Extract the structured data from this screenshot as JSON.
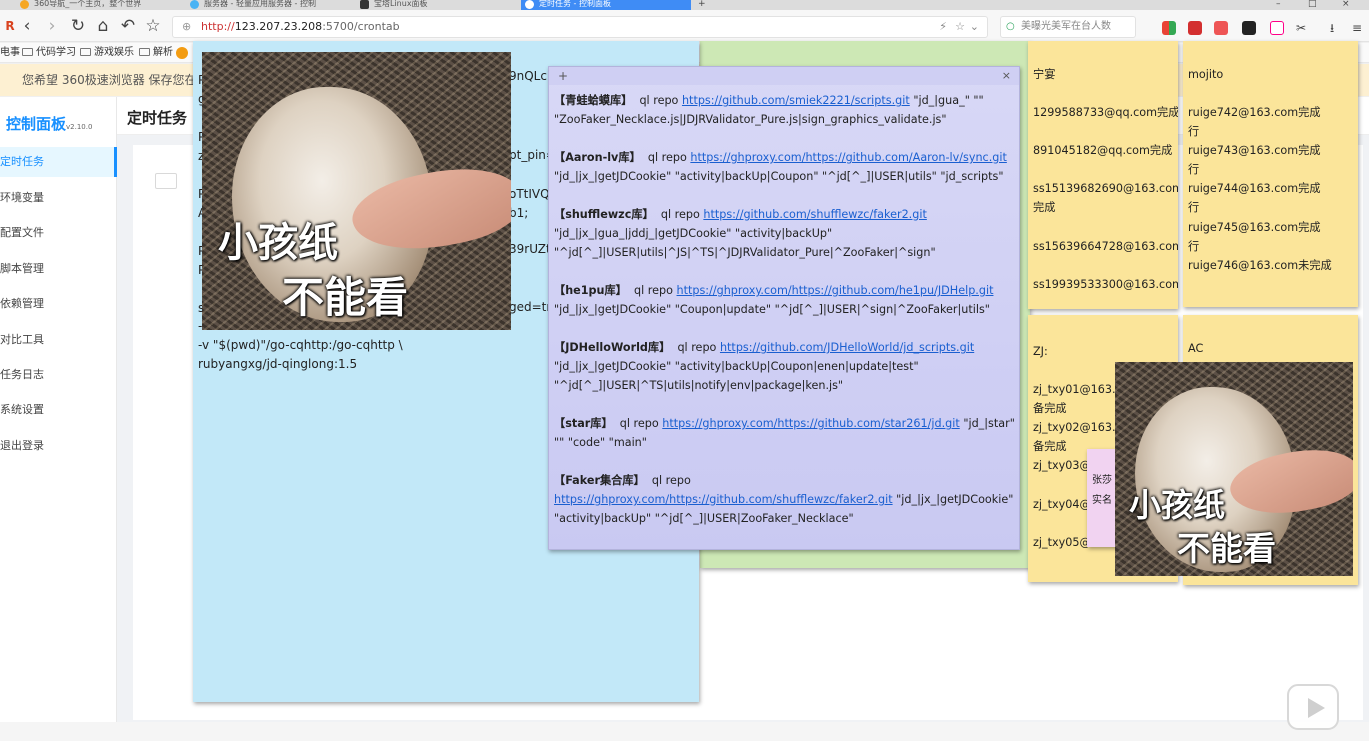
{
  "browser": {
    "tabs": [
      {
        "label": "360导航_一个主页，整个世界"
      },
      {
        "label": "服务器 - 轻量应用服务器 - 控制"
      },
      {
        "label": "宝塔Linux面板"
      },
      {
        "label": "定时任务 - 控制面板"
      }
    ],
    "url": {
      "scheme": "http://",
      "host": "123.207.23.208",
      "rest": ":5700/crontab"
    },
    "search_placeholder": "美曝光美军在台人数",
    "bookmarks": [
      "电事",
      "代码学习",
      "游戏娱乐",
      "解析"
    ],
    "notice": "您希望 360极速浏览器 保存您在此"
  },
  "app": {
    "brand": "控制面板",
    "version": "v2.10.0",
    "page_title": "定时任务",
    "menu": [
      {
        "label": "定时任务",
        "active": true
      },
      {
        "label": "环境变量"
      },
      {
        "label": "配置文件"
      },
      {
        "label": "脚本管理"
      },
      {
        "label": "依赖管理"
      },
      {
        "label": "对比工具"
      },
      {
        "label": "任务日志"
      },
      {
        "label": "系统设置"
      },
      {
        "label": "退出登录"
      }
    ]
  },
  "notes": {
    "blue": {
      "lines": [
        "-v \"$(pwd)\"/go-cqhttp:/go-cqhttp \\",
        "rubyangxg/jd-qinglong:1.5"
      ],
      "fragments": [
        "P",
        "g",
        "P",
        "z",
        "P",
        "A",
        "P",
        "P",
        "s",
        "9nQLcl",
        "pt_pin=",
        "oTtIVQC",
        "b1;",
        "39rUZts",
        "ged=tr",
        "-"
      ]
    },
    "purple": {
      "plus": "+",
      "close": "×",
      "entries": [
        {
          "name": "【青蛙蛤蟆库】",
          "cmd": "ql repo",
          "url": "https://github.com/smiek2221/scripts.git",
          "args": "\"jd_|gua_\" \"\" \"ZooFaker_Necklace.js|JDJRValidator_Pure.js|sign_graphics_validate.js\""
        },
        {
          "name": "【Aaron-lv库】",
          "cmd": "ql repo",
          "url": "https://ghproxy.com/https://github.com/Aaron-lv/sync.git",
          "args": "\"jd_|jx_|getJDCookie\" \"activity|backUp|Coupon\" \"^jd[^_]|USER|utils\" \"jd_scripts\""
        },
        {
          "name": "【shufflewzc库】",
          "cmd": "ql repo",
          "url": "https://github.com/shufflewzc/faker2.git",
          "args": "\"jd_|jx_|gua_|jddj_|getJDCookie\" \"activity|backUp\" \"^jd[^_]|USER|utils|^JS|^TS|^JDJRValidator_Pure|^ZooFaker|^sign\""
        },
        {
          "name": "【he1pu库】",
          "cmd": "ql repo",
          "url": "https://ghproxy.com/https://github.com/he1pu/JDHelp.git",
          "args": "\"jd_|jx_|getJDCookie\" \"Coupon|update\" \"^jd[^_]|USER|^sign|^ZooFaker|utils\""
        },
        {
          "name": "【JDHelloWorld库】",
          "cmd": "ql repo",
          "url": "https://github.com/JDHelloWorld/jd_scripts.git",
          "args": "\"jd_|jx_|getJDCookie\" \"activity|backUp|Coupon|enen|update|test\" \"^jd[^_]|USER|^TS|utils|notify|env|package|ken.js\""
        },
        {
          "name": "【star库】",
          "cmd": "ql repo",
          "url": "https://ghproxy.com/https://github.com/star261/jd.git",
          "args": "\"jd_|star\" \"\" \"code\" \"main\""
        },
        {
          "name": "【Faker集合库】",
          "cmd": "ql repo",
          "url": "https://ghproxy.com/https://github.com/shufflewzc/faker2.git",
          "args": "\"jd_|jx_|getJDCookie\" \"activity|backUp\" \"^jd[^_]|USER|ZooFaker_Necklace\""
        }
      ]
    },
    "yellow1": {
      "lines": [
        "宁宴",
        "",
        "1299588733@qq.com完成",
        "",
        "891045182@qq.com完成",
        "",
        "ss15139682690@163.com",
        "完成",
        "",
        "ss15639664728@163.com",
        "",
        "ss19939533300@163.com"
      ]
    },
    "yellow2": {
      "lines": [
        "mojito",
        "",
        "ruige742@163.com完成",
        "行",
        "ruige743@163.com完成",
        "行",
        "ruige744@163.com完成",
        "行",
        "ruige745@163.com完成",
        "行",
        "ruige746@163.com未完成"
      ]
    },
    "yellow3": {
      "lines": [
        "ZJ:",
        "",
        "zj_txy01@163.c",
        "备完成",
        "zj_txy02@163.c",
        "备完成",
        "zj_txy03@",
        "",
        "zj_txy04@",
        "",
        "zj_txy05@"
      ]
    },
    "yellow4": {
      "lines": [
        "AC"
      ]
    },
    "pink": {
      "lines": [
        "张莎",
        "实名"
      ]
    }
  },
  "memes": {
    "caption_line1": "小孩纸",
    "caption_line2": "不能看"
  },
  "colors": {
    "accent": "#1890ff",
    "note_blue": "#c2e8f8",
    "note_green": "#cde8b5",
    "note_purple": "#d8d8f6",
    "note_yellow": "#fbe59a",
    "note_pink": "#f1d3f1"
  }
}
